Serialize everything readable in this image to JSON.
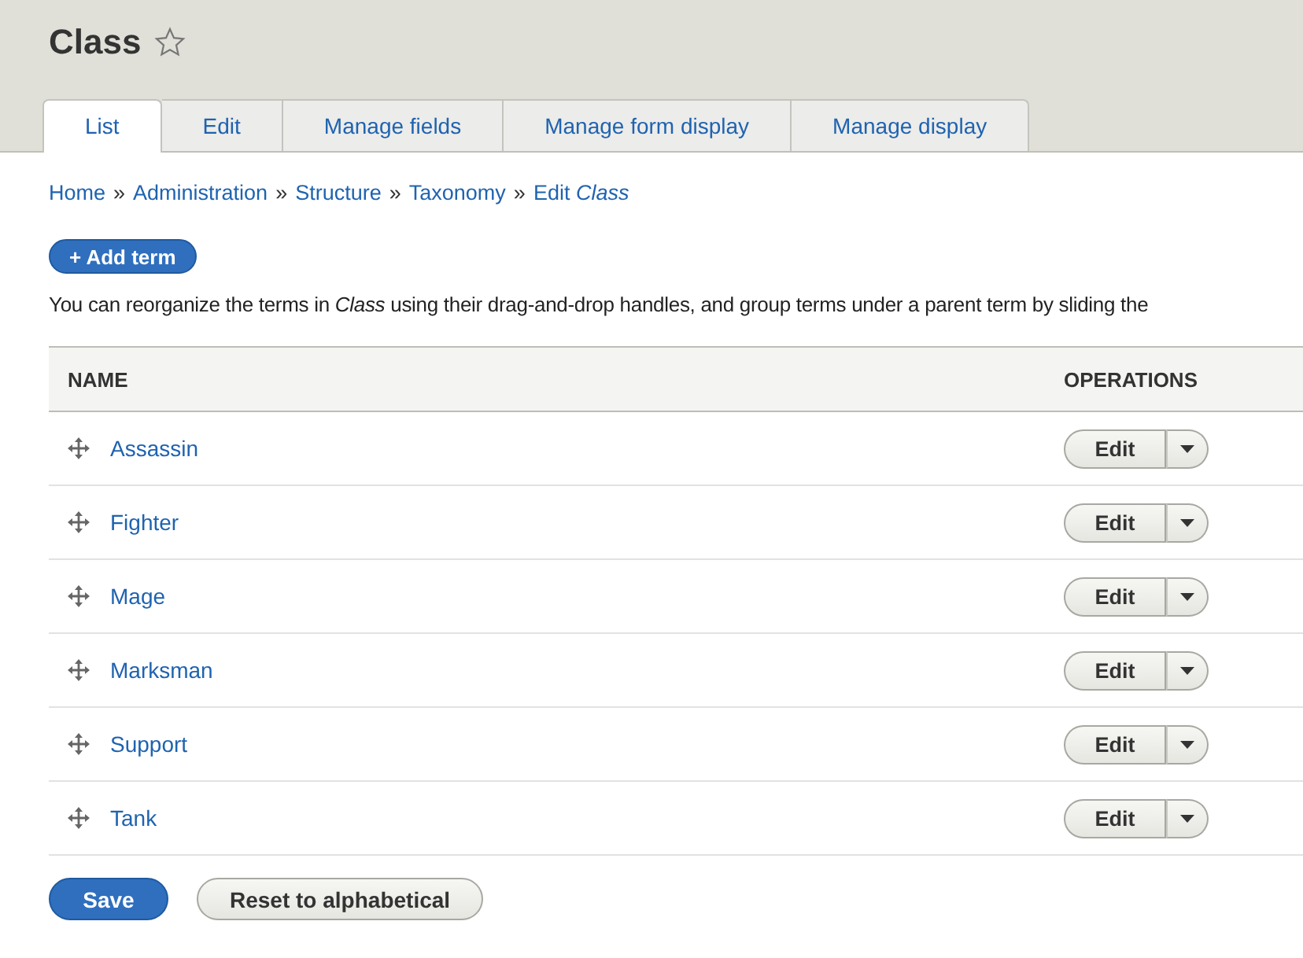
{
  "page_title": "Class",
  "tabs": [
    {
      "label": "List",
      "selected": true
    },
    {
      "label": "Edit",
      "selected": false
    },
    {
      "label": "Manage fields",
      "selected": false
    },
    {
      "label": "Manage form display",
      "selected": false
    },
    {
      "label": "Manage display",
      "selected": false
    }
  ],
  "breadcrumb": [
    "Home",
    "Administration",
    "Structure",
    "Taxonomy",
    "Edit *Class*"
  ],
  "breadcrumb_separator": "»",
  "add_button": "+ Add term",
  "description": "You can reorganize the terms in *Class* using their drag-and-drop handles, and group terms under a parent term by sliding the",
  "table": {
    "columns": [
      "NAME",
      "OPERATIONS"
    ],
    "rows": [
      {
        "name": "Assassin",
        "operation": "Edit"
      },
      {
        "name": "Fighter",
        "operation": "Edit"
      },
      {
        "name": "Mage",
        "operation": "Edit"
      },
      {
        "name": "Marksman",
        "operation": "Edit"
      },
      {
        "name": "Support",
        "operation": "Edit"
      },
      {
        "name": "Tank",
        "operation": "Edit"
      }
    ]
  },
  "buttons": [
    {
      "label": "Save",
      "kind": "primary"
    },
    {
      "label": "Reset to alphabetical",
      "kind": "secondary"
    }
  ]
}
